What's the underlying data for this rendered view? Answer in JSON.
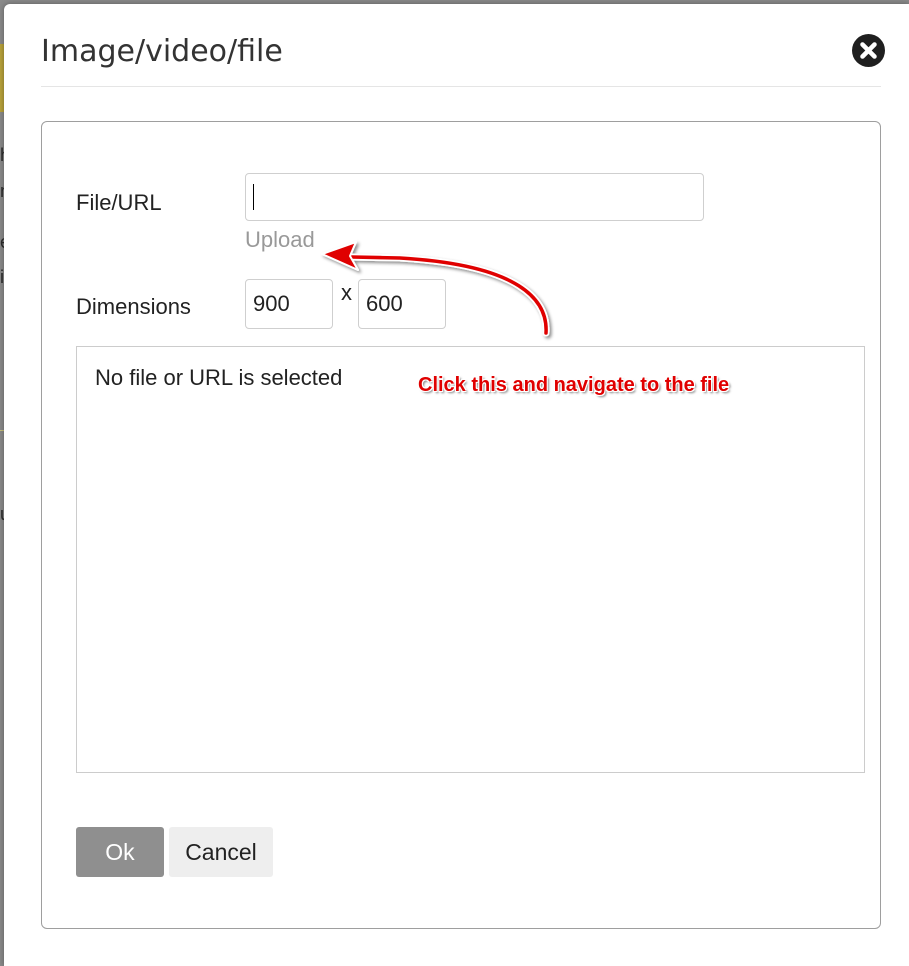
{
  "dialog": {
    "title": "Image/video/file",
    "close_icon": "close-icon"
  },
  "form": {
    "file_url_label": "File/URL",
    "file_url_value": "",
    "upload_label": "Upload",
    "dimensions_label": "Dimensions",
    "width_value": "900",
    "height_value": "600",
    "separator": "x",
    "preview_message": "No file or URL is selected"
  },
  "buttons": {
    "ok_label": "Ok",
    "cancel_label": "Cancel"
  },
  "annotation": {
    "text": "Click this and navigate to the file",
    "color": "#e00000"
  }
}
